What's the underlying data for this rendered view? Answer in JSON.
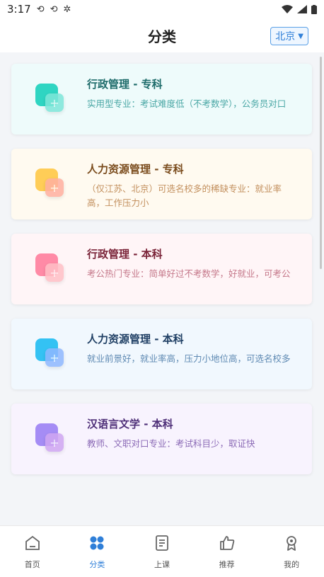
{
  "status": {
    "time": "3:17",
    "icons": [
      "sync-icon",
      "sync-icon",
      "bug-icon"
    ]
  },
  "header": {
    "title": "分类",
    "city": "北京"
  },
  "cards": [
    {
      "title": "行政管理 - 专科",
      "desc": "实用型专业：考试难度低（不考数学），公务员对口",
      "bg": "#eefbfb",
      "title_color": "#1d6b6a",
      "desc_color": "#4aa7a5",
      "c1": "#2fd5c2",
      "c2": "#7ee7d9"
    },
    {
      "title": "人力资源管理 - 专科",
      "desc": "（仅江苏、北京）可选名校多的稀缺专业：就业率高，工作压力小",
      "bg": "#fffaf0",
      "title_color": "#7a4b1c",
      "desc_color": "#c3905e",
      "c1": "#ffcd57",
      "c2": "#ffb0a0"
    },
    {
      "title": "行政管理 - 本科",
      "desc": "考公热门专业：简单好过不考数学，好就业，可考公",
      "bg": "#fff5f7",
      "title_color": "#7a2338",
      "desc_color": "#c5788a",
      "c1": "#ff8aa6",
      "c2": "#ffc0c6"
    },
    {
      "title": "人力资源管理 - 本科",
      "desc": "就业前景好，就业率高，压力小地位高，可选名校多",
      "bg": "#f1f8fe",
      "title_color": "#1f3f64",
      "desc_color": "#5f8ab3",
      "c1": "#34c2f3",
      "c2": "#8fb8ff"
    },
    {
      "title": "汉语言文学 - 本科",
      "desc": "教师、文职对口专业：考试科目少，取证快",
      "bg": "#f8f3fe",
      "title_color": "#4e2f78",
      "desc_color": "#8b6ab6",
      "c1": "#a58cf5",
      "c2": "#d0a6f2"
    }
  ],
  "tabs": [
    {
      "label": "首页",
      "icon": "home-icon"
    },
    {
      "label": "分类",
      "icon": "grid-icon",
      "active": true
    },
    {
      "label": "上课",
      "icon": "book-icon"
    },
    {
      "label": "推荐",
      "icon": "thumbs-up-icon"
    },
    {
      "label": "我的",
      "icon": "profile-icon"
    }
  ]
}
